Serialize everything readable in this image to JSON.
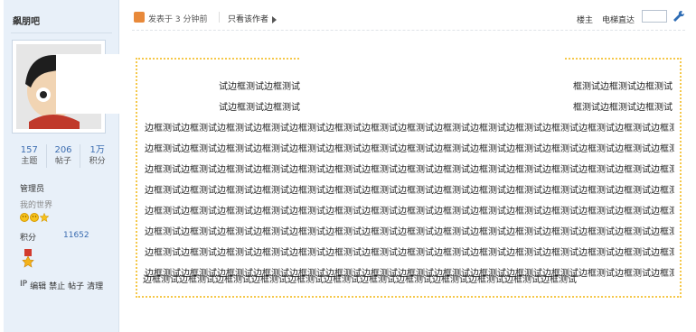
{
  "sidebar": {
    "username": "飙朋吧",
    "stats": [
      {
        "num": "157",
        "label": "主题"
      },
      {
        "num": "206",
        "label": "帖子"
      },
      {
        "num": "1万",
        "label": "积分"
      }
    ],
    "role": "管理员",
    "subtitle": "我的世界",
    "score_label": "积分",
    "score_value": "11652",
    "admin_links": [
      "IP",
      "编辑",
      "禁止",
      "帖子",
      "清理"
    ]
  },
  "topbar": {
    "post_time": "发表于 3 分钟前",
    "only_author": "只看该作者",
    "floor_owner": "楼主",
    "elevator": "电梯直达"
  },
  "post": {
    "partial_lines": [
      {
        "left": "试边框测试边框测试",
        "right": "框测试边框测试边框测试"
      },
      {
        "left": "试边框测试边框测试",
        "right": "框测试边框测试边框测试"
      }
    ],
    "full_lines": [
      "边框测试边框测试边框测试边框测试边框测试边框测试边框测试边框测试边框测试边框测试边框测试边框测试边框测试边框测试边框测试",
      "边框测试边框测试边框测试边框测试边框测试边框测试边框测试边框测试边框测试边框测试边框测试边框测试边框测试边框测试边框测试",
      "边框测试边框测试边框测试边框测试边框测试边框测试边框测试边框测试边框测试边框测试边框测试边框测试边框测试边框测试边框测试",
      "边框测试边框测试边框测试边框测试边框测试边框测试边框测试边框测试边框测试边框测试边框测试边框测试边框测试边框测试边框测试",
      "边框测试边框测试边框测试边框测试边框测试边框测试边框测试边框测试边框测试边框测试边框测试边框测试边框测试边框测试边框测试",
      "边框测试边框测试边框测试边框测试边框测试边框测试边框测试边框测试边框测试边框测试边框测试边框测试边框测试边框测试边框测试",
      "边框测试边框测试边框测试边框测试边框测试边框测试边框测试边框测试边框测试边框测试边框测试边框测试边框测试边框测试边框测试",
      "边框测试边框测试边框测试边框测试边框测试边框测试边框测试边框测试边框测试边框测试边框测试边框测试边框测试边框测试边框测试"
    ],
    "last_line": "边框测试边框测试边框测试边框测试边框测试边框测试边框测试边框测试边框测试边框测试边框测试边框测试"
  },
  "colors": {
    "sidebar_bg": "#e8f0f9",
    "accent_blue": "#3b6cb0",
    "dotted_border": "#f5c84a",
    "post_icon": "#e8893a"
  },
  "icons": [
    "post-time-icon",
    "caret-right-icon",
    "wrench-icon",
    "level-star-icon",
    "medal-icon",
    "avatar-image"
  ]
}
